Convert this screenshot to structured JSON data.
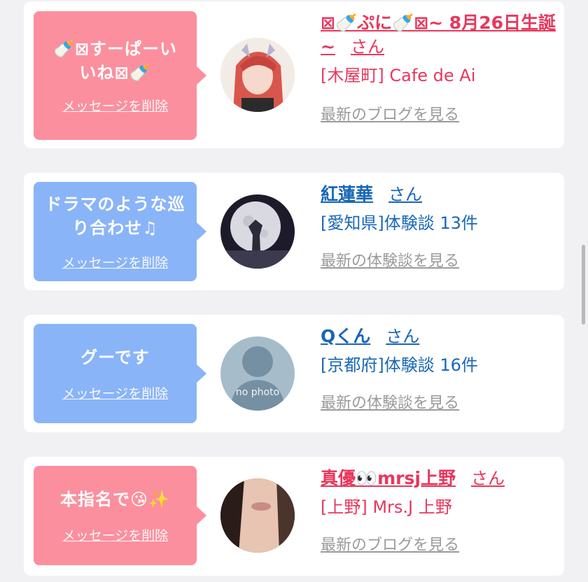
{
  "colors": {
    "pink": "#fb8f9e",
    "blue": "#8ab4f8",
    "name_pink": "#e8375d",
    "name_blue": "#1867b6",
    "link_gray": "#9a9a9a"
  },
  "cards": [
    {
      "message": "🍼⊠すーぱーいいね⊠🍼",
      "delete": "メッセージを削除",
      "name": "⊠🍼ぷに🍼⊠~ 8月26日生誕~",
      "san": "さん",
      "shop": "[木屋町] Cafe de Ai",
      "more": "最新のブログを見る"
    },
    {
      "message": "ドラマのような巡り合わせ♫",
      "delete": "メッセージを削除",
      "name": "紅蓮華",
      "san": "さん",
      "shop": "[愛知県]体験談 13件",
      "more": "最新の体験談を見る"
    },
    {
      "message": "グーです",
      "delete": "メッセージを削除",
      "name": "Qくん",
      "san": "さん",
      "shop": "[京都府]体験談 16件",
      "more": "最新の体験談を見る",
      "avatar_text": "no photo"
    },
    {
      "message": "本指名で😘✨",
      "delete": "メッセージを削除",
      "name": "真優👀mrsj上野",
      "san": "さん",
      "shop": "[上野] Mrs.J 上野",
      "more": "最新のブログを見る"
    }
  ]
}
